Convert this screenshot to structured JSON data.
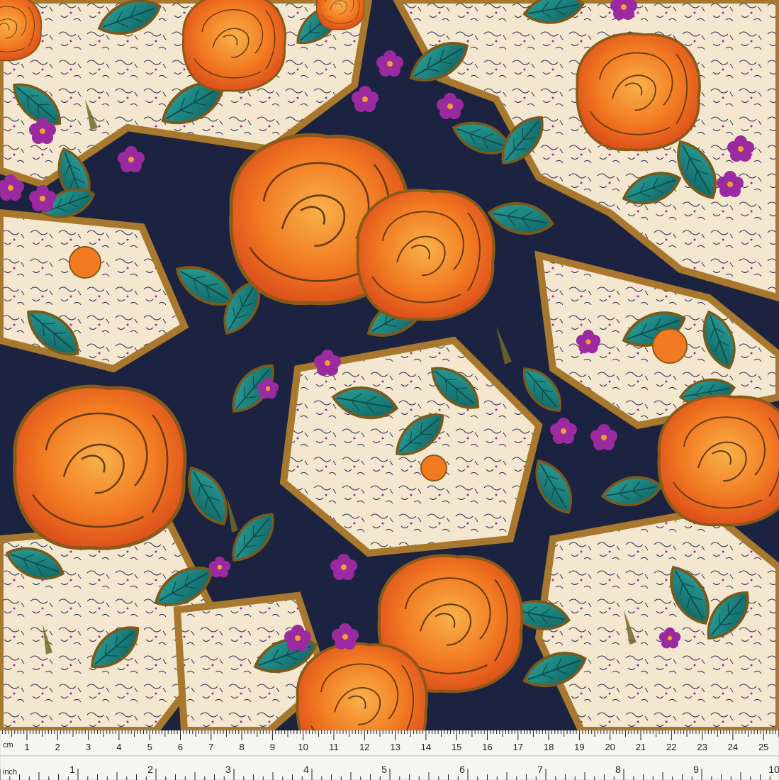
{
  "image": {
    "subject": "floral-print-fabric-swatch",
    "colors": {
      "background_navy": "#1b2340",
      "cream": "#f4e7cf",
      "ochre": "#a8782f",
      "olive": "#6f6a2a",
      "rose_orange": "#f0701e",
      "rose_light": "#f7a340",
      "rose_dark": "#c8401a",
      "leaf_teal": "#1f8a86",
      "leaf_dark": "#0f5f5f",
      "violet": "#9b2aa0",
      "outline": "#5a3a10"
    }
  },
  "ruler": {
    "cm_unit": "cm",
    "inch_unit": "inch",
    "cm_labels": [
      "1",
      "2",
      "3",
      "4",
      "5",
      "6",
      "7",
      "8",
      "9",
      "10",
      "11",
      "12",
      "13",
      "14",
      "15",
      "16",
      "17",
      "18",
      "19",
      "20",
      "21",
      "22",
      "23",
      "24",
      "25"
    ],
    "inch_labels": [
      "1",
      "2",
      "3",
      "4",
      "5",
      "6",
      "7",
      "8",
      "9",
      "10"
    ]
  }
}
